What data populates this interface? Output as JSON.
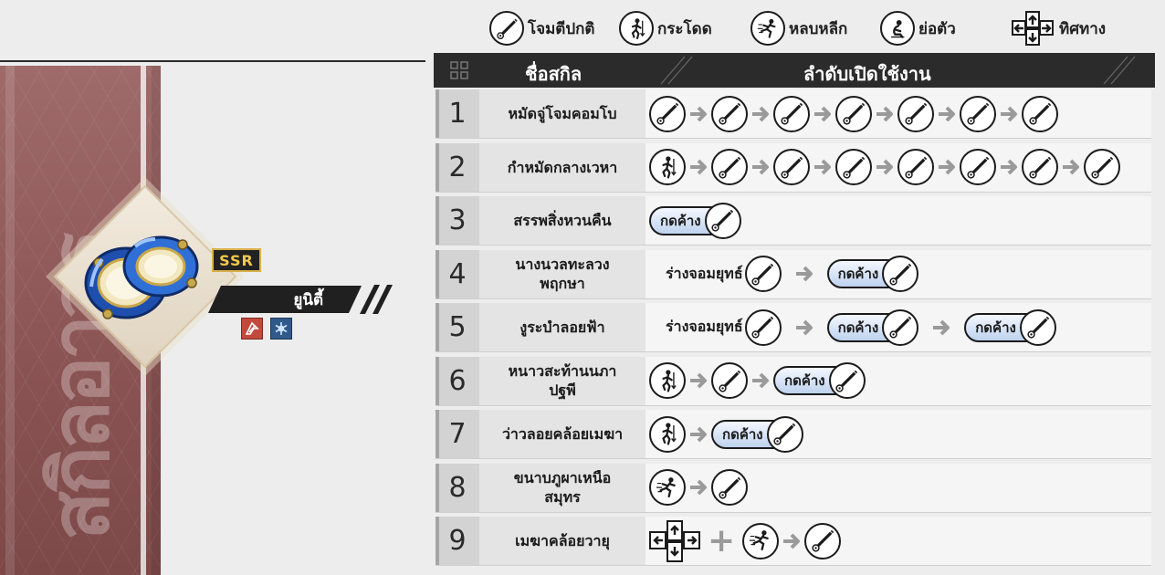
{
  "legend": {
    "attack": "โจมตีปกติ",
    "jump": "กระโดด",
    "dodge": "หลบหลีก",
    "crouch": "ย่อตัว",
    "direction": "ทิศทาง"
  },
  "character": {
    "vertical_title": "สกิลอาวุธ",
    "rarity": "SSR",
    "name": "ยูนิตี้"
  },
  "table": {
    "header_name": "ชื่อสกิล",
    "header_order": "ลำดับเปิดใช้งาน"
  },
  "hold_label": "กดค้าง",
  "stance_label": "ร่างจอมยุทธ์",
  "skills": [
    {
      "num": "1",
      "name": "หมัดจู่โจมคอมโบ",
      "sequence": [
        "attack",
        "attack",
        "attack",
        "attack",
        "attack",
        "attack",
        "attack"
      ]
    },
    {
      "num": "2",
      "name": "กำหมัดกลางเวหา",
      "sequence": [
        "jump",
        "attack",
        "attack",
        "attack",
        "attack",
        "attack",
        "attack",
        "attack"
      ]
    },
    {
      "num": "3",
      "name": "สรรพสิ่งหวนคืน",
      "sequence": [
        "hold-attack"
      ]
    },
    {
      "num": "4",
      "name": "นางนวลทะลวงพฤกษา",
      "sequence": [
        "stance-attack",
        "hold-attack"
      ]
    },
    {
      "num": "5",
      "name": "งูระบำลอยฟ้า",
      "sequence": [
        "stance-attack",
        "hold-attack",
        "hold-attack"
      ]
    },
    {
      "num": "6",
      "name": "หนาวสะท้านนภาปฐพี",
      "sequence": [
        "jump",
        "attack",
        "hold-attack"
      ]
    },
    {
      "num": "7",
      "name": "ว่าวลอยคล้อยเมฆา",
      "sequence": [
        "jump",
        "hold-attack"
      ]
    },
    {
      "num": "8",
      "name": "ขนาบภูผาเหนือสมุทร",
      "sequence": [
        "dodge",
        "attack"
      ]
    },
    {
      "num": "9",
      "name": "เมฆาคล้อยวายุ",
      "sequence": [
        "direction",
        "plus",
        "dodge",
        "attack"
      ]
    }
  ],
  "colors": {
    "panel": "#8a5353",
    "header": "#2b2b2b",
    "rarity_gold": "#f3c94a",
    "hold_pill": "#bed2ee",
    "weapon_blue": "#2f6fd6"
  }
}
